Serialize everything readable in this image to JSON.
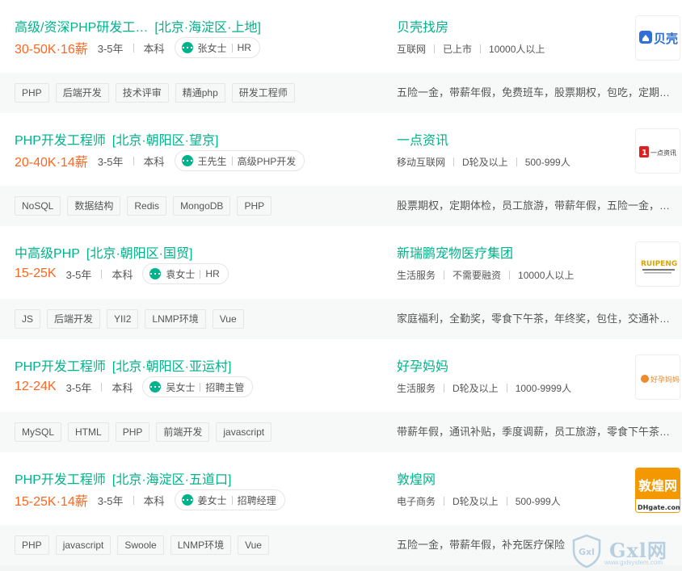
{
  "jobs": [
    {
      "title": "高级/资深PHP研发工…",
      "location": "[北京·海淀区·上地]",
      "salary": "30-50K·16薪",
      "experience": "3-5年",
      "education": "本科",
      "hr_name": "张女士",
      "hr_role": "HR",
      "company": "贝壳找房",
      "industry": "互联网",
      "stage": "已上市",
      "size": "10000人以上",
      "tags": [
        "PHP",
        "后端开发",
        "技术评审",
        "精通php",
        "研发工程师"
      ],
      "benefits": "五险一金，带薪年假，免费班车，股票期权，包吃，定期…",
      "logo_text": "贝壳",
      "logo_subtext": "",
      "logo_color": "#2f6fd6"
    },
    {
      "title": "PHP开发工程师",
      "location": "[北京·朝阳区·望京]",
      "salary": "20-40K·14薪",
      "experience": "3-5年",
      "education": "本科",
      "hr_name": "王先生",
      "hr_role": "高级PHP开发",
      "company": "一点资讯",
      "industry": "移动互联网",
      "stage": "D轮及以上",
      "size": "500-999人",
      "tags": [
        "NoSQL",
        "数据结构",
        "Redis",
        "MongoDB",
        "PHP"
      ],
      "benefits": "股票期权，定期体检，员工旅游，带薪年假，五险一金，…",
      "logo_text": "一点资讯",
      "logo_subtext": "",
      "logo_color": "#e02020"
    },
    {
      "title": "中高级PHP",
      "location": "[北京·朝阳区·国贸]",
      "salary": "15-25K",
      "experience": "3-5年",
      "education": "本科",
      "hr_name": "袁女士",
      "hr_role": "HR",
      "company": "新瑞鹏宠物医疗集团",
      "industry": "生活服务",
      "stage": "不需要融资",
      "size": "10000人以上",
      "tags": [
        "JS",
        "后端开发",
        "YII2",
        "LNMP环境",
        "Vue"
      ],
      "benefits": "家庭福利，全勤奖，零食下午茶，年终奖，包住，交通补…",
      "logo_text": "RUIPENG",
      "logo_subtext": "",
      "logo_color": "#d9a400"
    },
    {
      "title": "PHP开发工程师",
      "location": "[北京·朝阳区·亚运村]",
      "salary": "12-24K",
      "experience": "3-5年",
      "education": "本科",
      "hr_name": "吴女士",
      "hr_role": "招聘主管",
      "company": "好孕妈妈",
      "industry": "生活服务",
      "stage": "D轮及以上",
      "size": "1000-9999人",
      "tags": [
        "MySQL",
        "HTML",
        "PHP",
        "前端开发",
        "javascript"
      ],
      "benefits": "带薪年假，通讯补贴，季度调薪，员工旅游，零食下午茶…",
      "logo_text": "好孕妈妈",
      "logo_subtext": "",
      "logo_color": "#f08a2c"
    },
    {
      "title": "PHP开发工程师",
      "location": "[北京·海淀区·五道口]",
      "salary": "15-25K·14薪",
      "experience": "3-5年",
      "education": "本科",
      "hr_name": "姜女士",
      "hr_role": "招聘经理",
      "company": "敦煌网",
      "industry": "电子商务",
      "stage": "D轮及以上",
      "size": "500-999人",
      "tags": [
        "PHP",
        "javascript",
        "Swoole",
        "LNMP环境",
        "Vue"
      ],
      "benefits": "五险一金，带薪年假，补充医疗保险",
      "logo_text": "敦煌网",
      "logo_subtext": "DHgate.com",
      "logo_color": "#f39800"
    }
  ],
  "watermark": {
    "text": "Gxl网",
    "url": "www.gxlsystem.com"
  }
}
